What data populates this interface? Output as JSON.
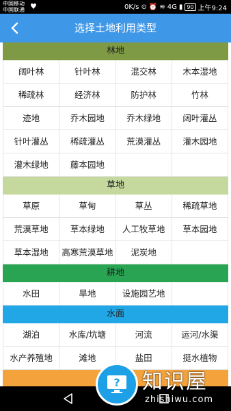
{
  "statusbar": {
    "carrier1": "中国移动",
    "carrier2": "中国联通",
    "speed": "0K/s",
    "network": "4G",
    "battery": "90",
    "time": "上午9:24"
  },
  "header": {
    "title": "选择土地利用类型"
  },
  "sections": [
    {
      "title": "林地",
      "color": "#7f9a45",
      "items": [
        "阔叶林",
        "针叶林",
        "混交林",
        "木本湿地",
        "稀疏林",
        "经济林",
        "防护林",
        "竹林",
        "迹地",
        "乔木园地",
        "乔木绿地",
        "阔叶灌丛",
        "针叶灌丛",
        "稀疏灌丛",
        "荒漠灌丛",
        "灌木园地",
        "灌木绿地",
        "藤本园地"
      ]
    },
    {
      "title": "草地",
      "color": "#c5d99e",
      "items": [
        "草原",
        "草甸",
        "草丛",
        "稀疏草地",
        "荒漠草地",
        "草本绿地",
        "人工牧草地",
        "草本园地",
        "草本湿地",
        "高寒荒漠草地",
        "泥炭地"
      ]
    },
    {
      "title": "耕地",
      "color": "#28a452",
      "items": [
        "水田",
        "旱地",
        "设施园艺地"
      ]
    },
    {
      "title": "水面",
      "color": "#22a7e6",
      "items": [
        "湖泊",
        "水库/坑塘",
        "河流",
        "运河/水渠",
        "水产养殖地",
        "滩地",
        "盐田",
        "挺水植物"
      ]
    },
    {
      "title": "",
      "color": "#f4a23c",
      "items": []
    }
  ],
  "watermark": {
    "text": "知识屋",
    "url": "zhishiwu.com"
  }
}
